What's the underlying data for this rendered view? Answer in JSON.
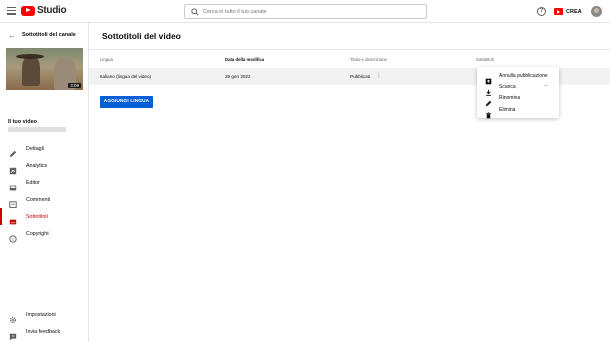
{
  "app": {
    "logo_text": "Studio",
    "brand_color": "#ff0000",
    "accent_color": "#065fd4"
  },
  "topbar": {
    "search_placeholder": "Cerca in tutto il tuo canale",
    "help_icon": "?",
    "create_label": "CREA"
  },
  "sidebar": {
    "back_label": "Sottotitoli del canale",
    "thumbnail_duration": "3:09",
    "your_video_label": "Il tuo video",
    "items": [
      {
        "label": "Dettagli",
        "icon": "pencil-icon"
      },
      {
        "label": "Analytics",
        "icon": "analytics-icon"
      },
      {
        "label": "Editor",
        "icon": "editor-icon"
      },
      {
        "label": "Commenti",
        "icon": "comments-icon"
      },
      {
        "label": "Sottotitoli",
        "icon": "subtitles-icon",
        "active": true
      },
      {
        "label": "Copyright",
        "icon": "copyright-icon"
      }
    ],
    "bottom_items": [
      {
        "label": "Impostazioni",
        "icon": "gear-icon"
      },
      {
        "label": "Invia feedback",
        "icon": "feedback-icon"
      }
    ]
  },
  "main": {
    "title": "Sottotitoli del video",
    "columns": [
      "Lingua",
      "Data della modifica",
      "Titolo e descrizione",
      "Sottotitoli"
    ],
    "rows": [
      {
        "language": "Italiano (lingua del video)",
        "date": "29 gen 2022",
        "title_desc": "Pubblicati"
      }
    ],
    "add_language_label": "AGGIUNGI LINGUA"
  },
  "menu": {
    "items": [
      {
        "label": "Annulla pubblicazione",
        "icon": "unpublish-icon"
      },
      {
        "label": "Scarica",
        "icon": "download-icon",
        "submenu": true
      },
      {
        "label": "Rinomina",
        "icon": "pencil-icon"
      },
      {
        "label": "Elimina",
        "icon": "trash-icon"
      }
    ]
  }
}
